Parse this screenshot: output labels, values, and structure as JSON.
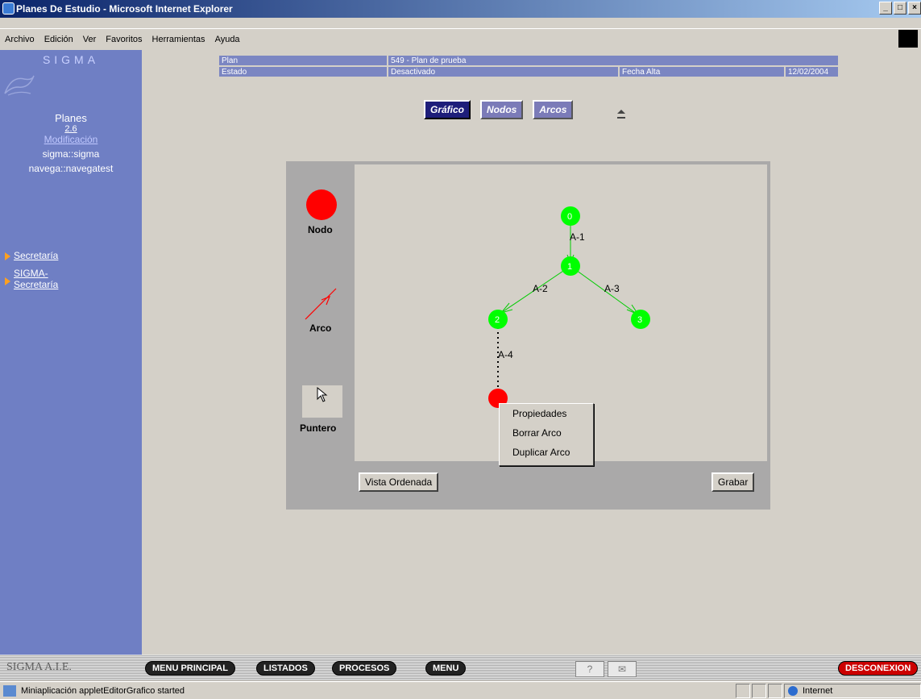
{
  "window": {
    "title": "Planes De Estudio - Microsoft Internet Explorer",
    "controls": [
      "_",
      "□",
      "×"
    ]
  },
  "menu": [
    "Archivo",
    "Edición",
    "Ver",
    "Favoritos",
    "Herramientas",
    "Ayuda"
  ],
  "sidebar": {
    "brand": "SIGMA",
    "module": "Planes",
    "version": "2.6",
    "mode": "Modificación",
    "user1": "sigma::sigma",
    "user2": "navega::navegatest",
    "nav": [
      {
        "label": "Secretaría"
      },
      {
        "label_line1": "SIGMA-",
        "label_line2": "Secretaría"
      }
    ]
  },
  "info": {
    "plan_label": "Plan",
    "plan_value": "549 - Plan de prueba",
    "estado_label": "Estado",
    "estado_value": "Desactivado",
    "fecha_label": "Fecha Alta",
    "fecha_value": "12/02/2004"
  },
  "tabs": [
    "Gráfico",
    "Nodos",
    "Arcos"
  ],
  "palette": {
    "node": "Nodo",
    "arc": "Arco",
    "pointer": "Puntero"
  },
  "graph": {
    "nodes": [
      "0",
      "1",
      "2",
      "3"
    ],
    "arcs": [
      "A-1",
      "A-2",
      "A-3",
      "A-4"
    ]
  },
  "buttons": {
    "vista": "Vista Ordenada",
    "grabar": "Grabar"
  },
  "context_menu": [
    "Propiedades",
    "Borrar Arco",
    "Duplicar Arco"
  ],
  "bottom": {
    "brand": "SIGMA A.I.E.",
    "menu_principal": "MENU PRINCIPAL",
    "listados": "LISTADOS",
    "procesos": "PROCESOS",
    "menu": "MENU",
    "help": "?",
    "mail": "✉",
    "desconexion": "DESCONEXION"
  },
  "status": {
    "text": "Miniaplicación appletEditorGrafico started",
    "zone": "Internet"
  },
  "colors": {
    "sidebar": "#6f7fc4",
    "node_green": "#00ff00",
    "node_red": "#ff0000"
  }
}
